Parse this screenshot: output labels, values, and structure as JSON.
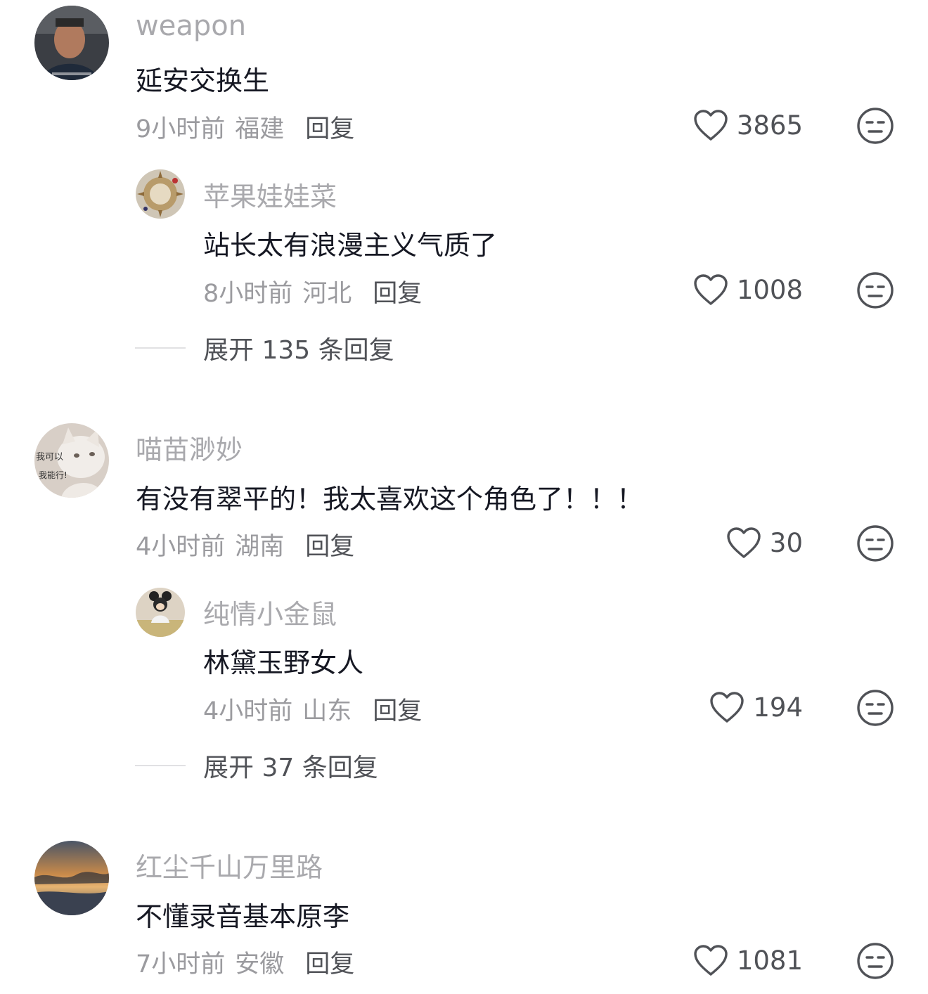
{
  "comments": [
    {
      "username": "weapon",
      "text": "延安交换生",
      "time": "9小时前",
      "location": "福建",
      "reply_label": "回复",
      "likes": "3865",
      "replies": [
        {
          "username": "苹果娃娃菜",
          "text": "站长太有浪漫主义气质了",
          "time": "8小时前",
          "location": "河北",
          "reply_label": "回复",
          "likes": "1008"
        }
      ],
      "expand_label": "展开 135 条回复"
    },
    {
      "username": "喵苗渺妙",
      "avatar_caption_1": "我可以",
      "avatar_caption_2": "我能行!",
      "text": "有没有翠平的！我太喜欢这个角色了！！！",
      "time": "4小时前",
      "location": "湖南",
      "reply_label": "回复",
      "likes": "30",
      "replies": [
        {
          "username": "纯情小金鼠",
          "text": "林黛玉野女人",
          "time": "4小时前",
          "location": "山东",
          "reply_label": "回复",
          "likes": "194"
        }
      ],
      "expand_label": "展开 37 条回复"
    },
    {
      "username": "红尘千山万里路",
      "text": "不懂录音基本原李",
      "time": "7小时前",
      "location": "安徽",
      "reply_label": "回复",
      "likes": "1081"
    }
  ],
  "icons": {
    "like": "heart-outline-icon",
    "dislike": "neutral-face-icon"
  },
  "colors": {
    "username": "#a9a9ad",
    "text": "#161823",
    "meta": "#9b9b9f",
    "action": "#505257"
  }
}
